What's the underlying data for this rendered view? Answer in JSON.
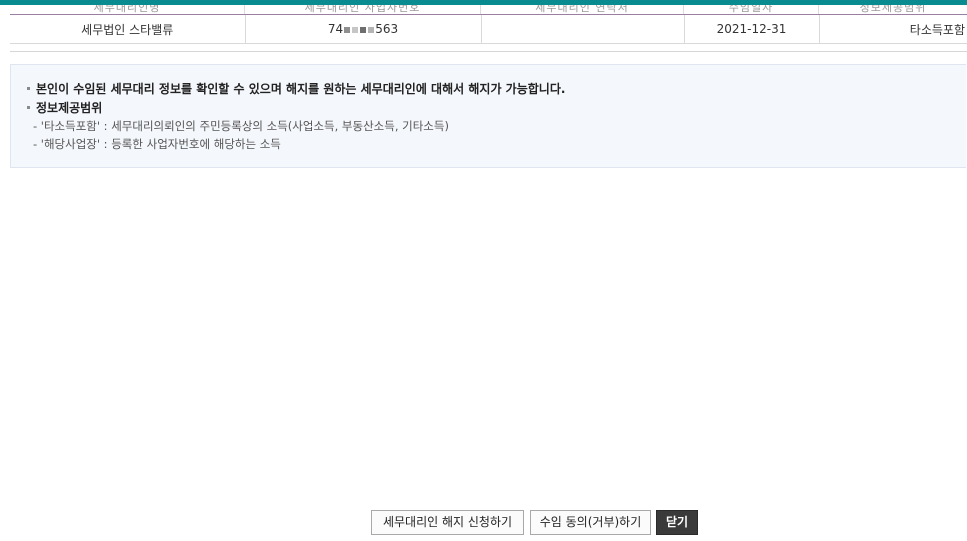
{
  "table": {
    "header_ghost": [
      "세무대리인명",
      "세무대리인 사업자번호",
      "세무대리인 연락처",
      "수임일자",
      "정보제공범위"
    ],
    "rows": [
      {
        "name": "세무법인 스타밸류",
        "bizno_prefix": "74",
        "bizno_suffix": "563",
        "contact": "",
        "date": "2021-12-31",
        "scope": "타소득포함"
      }
    ]
  },
  "info": {
    "line1": "본인이 수임된 세무대리 정보를 확인할 수 있으며 해지를 원하는 세무대리인에 대해서 해지가 가능합니다.",
    "line2": "정보제공범위",
    "line3": "- '타소득포함' : 세무대리의뢰인의 주민등록상의 소득(사업소득, 부동산소득, 기타소득)",
    "line4": "- '해당사업장' : 등록한 사업자번호에 해당하는 소득"
  },
  "buttons": {
    "cancel_agent": "세무대리인 해지 신청하기",
    "consent": "수임 동의(거부)하기",
    "close": "닫기"
  },
  "colors": {
    "top_bar": "#0a8b8f",
    "info_bg": "#f4f7fb",
    "close_button": "#3a3a3a"
  }
}
